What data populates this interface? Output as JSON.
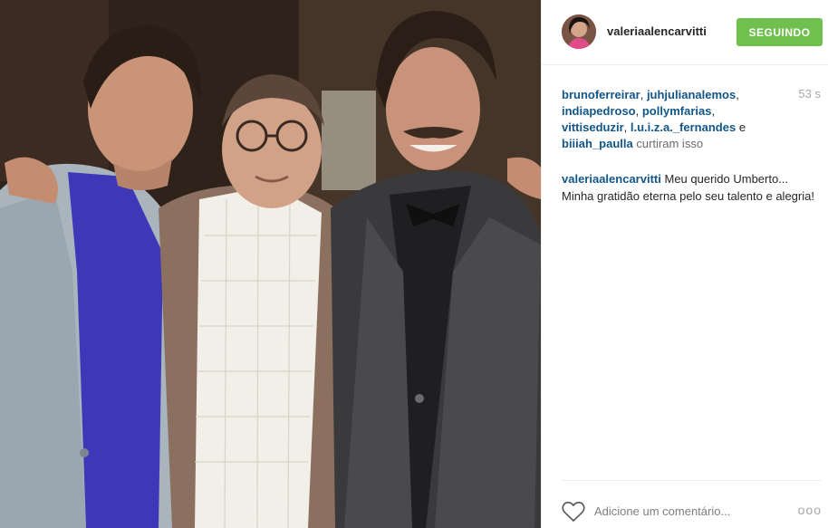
{
  "post": {
    "username": "valeriaalencarvitti",
    "follow_label": "SEGUINDO",
    "timestamp": "53 s",
    "likes": {
      "users": [
        "brunoferreirar",
        "juhjulianalemos",
        "indiapedroso",
        "pollymfarias",
        "vittiseduzir",
        "l.u.i.z.a._fernandes",
        "biiiah_paulla"
      ],
      "conjunction": "e",
      "suffix": "curtiram isso"
    },
    "caption": {
      "username": "valeriaalencarvitti",
      "text": "Meu querido Umberto... Minha gratidão eterna pelo seu talento e alegria!"
    },
    "comment_placeholder": "Adicione um comentário...",
    "more_label": "ooo"
  },
  "colors": {
    "follow_button": "#70c050",
    "link_username": "#125688",
    "timestamp": "#a5a7aa"
  },
  "icons": {
    "heart": "heart-icon",
    "more": "more-options-icon"
  }
}
